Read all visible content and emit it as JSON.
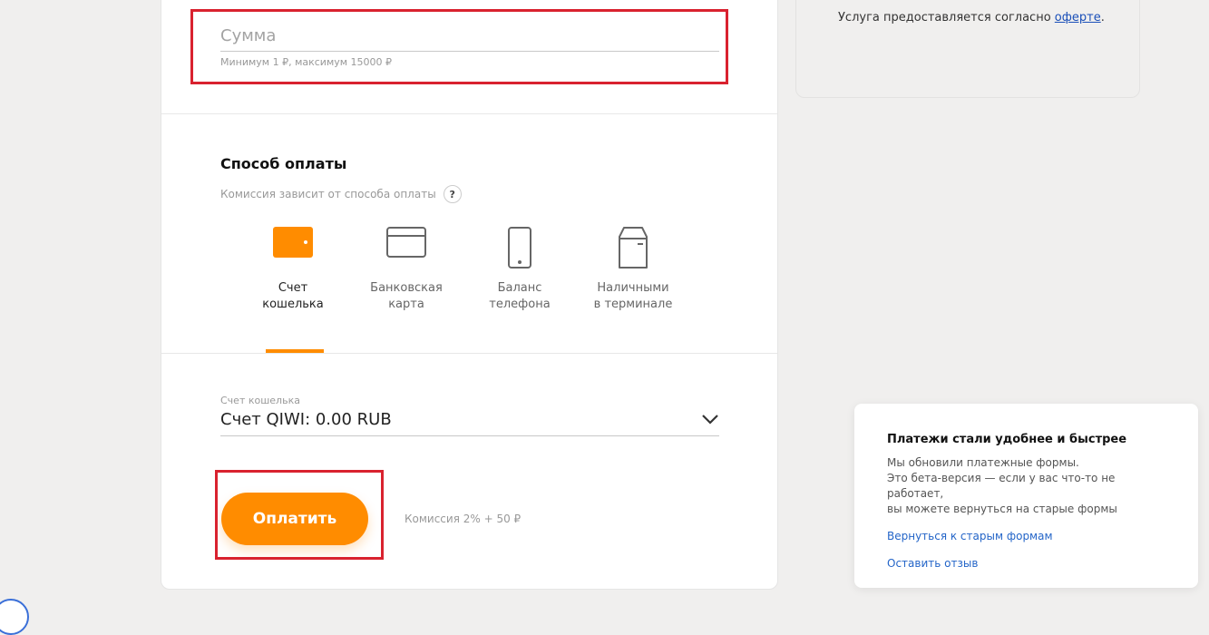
{
  "amount": {
    "placeholder": "Сумма",
    "value": "",
    "hint": "Минимум 1 ₽, максимум 15000 ₽"
  },
  "payment_method": {
    "title": "Способ оплаты",
    "subtitle": "Комиссия зависит от способа оплаты",
    "help_label": "?",
    "methods": [
      {
        "label_line1": "Счет",
        "label_line2": "кошелька",
        "icon": "wallet-icon",
        "selected": true
      },
      {
        "label_line1": "Банковская",
        "label_line2": "карта",
        "icon": "bank-card-icon",
        "selected": false
      },
      {
        "label_line1": "Баланс",
        "label_line2": "телефона",
        "icon": "phone-icon",
        "selected": false
      },
      {
        "label_line1": "Наличными",
        "label_line2": "в терминале",
        "icon": "terminal-icon",
        "selected": false
      }
    ]
  },
  "wallet": {
    "label": "Счет кошелька",
    "selected_value": "Счет QIWI: 0.00 RUB"
  },
  "pay": {
    "button_label": "Оплатить",
    "commission": "Комиссия 2% + 50 ₽"
  },
  "offer": {
    "text": "Услуга предоставляется согласно",
    "link": "оферте",
    "suffix": "."
  },
  "notification": {
    "title": "Платежи стали удобнее и быстрее",
    "body_line1": "Мы обновили платежные формы.",
    "body_line2": "Это бета-версия — если у вас что-то не работает,",
    "body_line3": "вы можете вернуться на старые формы",
    "link_old_forms": "Вернуться к старым формам",
    "link_feedback": "Оставить отзыв"
  },
  "colors": {
    "accent": "#ff8c00",
    "highlight": "#d9222f",
    "link": "#1a4fb8"
  }
}
